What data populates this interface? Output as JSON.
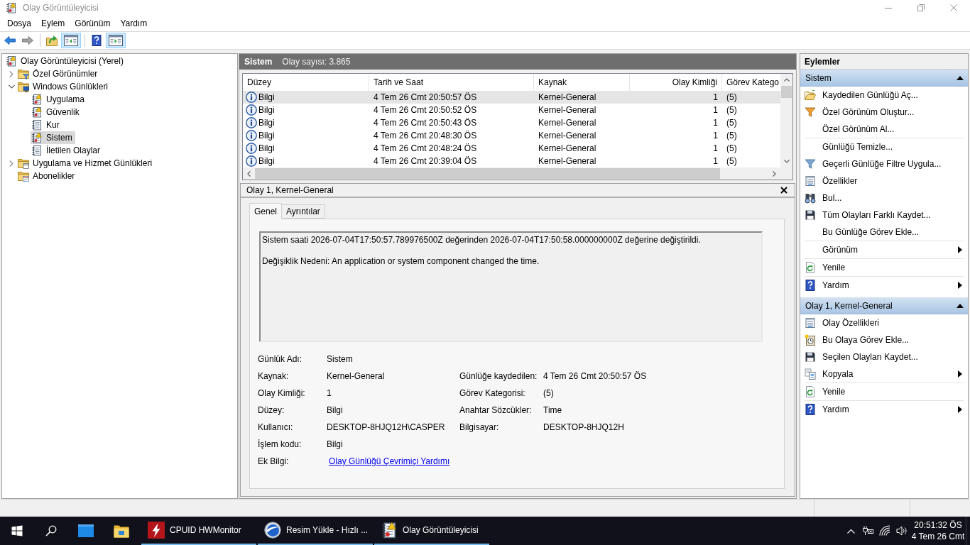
{
  "window": {
    "title": "Olay Görüntüleyicisi"
  },
  "menu": [
    {
      "label": "Dosya"
    },
    {
      "label": "Eylem"
    },
    {
      "label": "Görünüm"
    },
    {
      "label": "Yardım"
    }
  ],
  "toolbar": [
    [
      {
        "kind": "back",
        "disabled": false,
        "pressed": false
      },
      {
        "kind": "forward",
        "disabled": true,
        "pressed": false
      }
    ],
    [
      {
        "kind": "up",
        "disabled": false,
        "pressed": false
      },
      {
        "kind": "show-tree",
        "disabled": false,
        "pressed": true
      }
    ],
    [
      {
        "kind": "help",
        "disabled": false,
        "pressed": false
      },
      {
        "kind": "show-actions",
        "disabled": false,
        "pressed": true
      }
    ]
  ],
  "tree": [
    {
      "label": "Olay Görüntüleyicisi (Yerel)",
      "kind": "event-viewer",
      "selected": false,
      "children": [
        {
          "label": "Özel Görünümler",
          "kind": "filter-folder",
          "expanded": false,
          "selected": false
        },
        {
          "label": "Windows Günlükleri",
          "kind": "windows-folder",
          "expanded": true,
          "selected": false,
          "children": [
            {
              "label": "Uygulama",
              "kind": "log-alert",
              "selected": false
            },
            {
              "label": "Güvenlik",
              "kind": "log-alert",
              "selected": false
            },
            {
              "label": "Kur",
              "kind": "log",
              "selected": false
            },
            {
              "label": "Sistem",
              "kind": "log-alert",
              "selected": true
            },
            {
              "label": "İletilen Olaylar",
              "kind": "log",
              "selected": false
            }
          ]
        },
        {
          "label": "Uygulama ve Hizmet Günlükleri",
          "kind": "folder",
          "expanded": false,
          "selected": false
        },
        {
          "label": "Abonelikler",
          "kind": "subscription-folder",
          "selected": false
        }
      ]
    }
  ],
  "event_list": {
    "title": "Sistem",
    "count": "Olay sayısı: 3.865",
    "columns": [
      "Düzey",
      "Tarih ve Saat",
      "Kaynak",
      "Olay Kimliği",
      "Görev Katego"
    ],
    "rows": [
      {
        "level": "Bilgi",
        "date": "4 Tem 26 Cmt 20:50:57 ÖS",
        "source": "Kernel-General",
        "event_id": "1",
        "category": "(5)",
        "selected": true
      },
      {
        "level": "Bilgi",
        "date": "4 Tem 26 Cmt 20:50:52 ÖS",
        "source": "Kernel-General",
        "event_id": "1",
        "category": "(5)",
        "selected": false
      },
      {
        "level": "Bilgi",
        "date": "4 Tem 26 Cmt 20:50:43 ÖS",
        "source": "Kernel-General",
        "event_id": "1",
        "category": "(5)",
        "selected": false
      },
      {
        "level": "Bilgi",
        "date": "4 Tem 26 Cmt 20:48:30 ÖS",
        "source": "Kernel-General",
        "event_id": "1",
        "category": "(5)",
        "selected": false
      },
      {
        "level": "Bilgi",
        "date": "4 Tem 26 Cmt 20:48:24 ÖS",
        "source": "Kernel-General",
        "event_id": "1",
        "category": "(5)",
        "selected": false
      },
      {
        "level": "Bilgi",
        "date": "4 Tem 26 Cmt 20:39:04 ÖS",
        "source": "Kernel-General",
        "event_id": "1",
        "category": "(5)",
        "selected": false
      }
    ]
  },
  "event_detail": {
    "title": "Olay 1, Kernel-General",
    "tabs": [
      {
        "label": "Genel",
        "selected": true
      },
      {
        "label": "Ayrıntılar",
        "selected": false
      }
    ],
    "message": [
      "Sistem saati 2026-07-04T17:50:57.789976500Z değerinden 2026-07-04T17:50:58.000000000Z değerine değiştirildi.",
      "Değişiklik Nedeni: An application or system component changed the time."
    ],
    "properties": [
      [
        {
          "label": "Günlük Adı:",
          "value": "Sistem"
        }
      ],
      [
        {
          "label": "Kaynak:",
          "value": "Kernel-General"
        },
        {
          "label": "Günlüğe kaydedilen:",
          "value": "4 Tem 26 Cmt 20:50:57 ÖS"
        }
      ],
      [
        {
          "label": "Olay Kimliği:",
          "value": "1"
        },
        {
          "label": "Görev Kategorisi:",
          "value": "(5)"
        }
      ],
      [
        {
          "label": "Düzey:",
          "value": "Bilgi"
        },
        {
          "label": "Anahtar Sözcükler:",
          "value": "Time"
        }
      ],
      [
        {
          "label": "Kullanıcı:",
          "value": "DESKTOP-8HJQ12H\\CASPER"
        },
        {
          "label": "Bilgisayar:",
          "value": "DESKTOP-8HJQ12H"
        }
      ],
      [
        {
          "label": "İşlem kodu:",
          "value": "Bilgi"
        }
      ],
      [
        {
          "label": "Ek Bilgi:",
          "link": "Olay Günlüğü Çevrimiçi Yardımı"
        }
      ]
    ]
  },
  "actions": {
    "title": "Eylemler",
    "sections": [
      {
        "title": "Sistem",
        "expanded": true,
        "groups": [
          [
            {
              "label": "Kaydedilen Günlüğü Aç...",
              "kind": "open-log",
              "submenu": false
            },
            {
              "label": "Özel Görünüm Oluştur...",
              "kind": "create-view",
              "submenu": false
            },
            {
              "label": "Özel Görünüm Al...",
              "kind": "import-view",
              "submenu": false
            }
          ],
          [
            {
              "label": "Günlüğü Temizle...",
              "kind": "clear-log",
              "submenu": false
            },
            {
              "label": "Geçerli Günlüğe Filtre Uygula...",
              "kind": "filter",
              "submenu": false
            },
            {
              "label": "Özellikler",
              "kind": "properties",
              "submenu": false
            },
            {
              "label": "Bul...",
              "kind": "find",
              "submenu": false
            },
            {
              "label": "Tüm Olayları Farklı Kaydet...",
              "kind": "save",
              "submenu": false
            },
            {
              "label": "Bu Günlüğe Görev Ekle...",
              "kind": "attach-task",
              "submenu": false
            }
          ],
          [
            {
              "label": "Görünüm",
              "kind": "view",
              "submenu": true
            }
          ],
          [
            {
              "label": "Yenile",
              "kind": "refresh",
              "submenu": false
            }
          ],
          [
            {
              "label": "Yardım",
              "kind": "help",
              "submenu": true
            }
          ]
        ]
      },
      {
        "title": "Olay 1, Kernel-General",
        "expanded": true,
        "groups": [
          [
            {
              "label": "Olay Özellikleri",
              "kind": "properties",
              "submenu": false
            },
            {
              "label": "Bu Olaya Görev Ekle...",
              "kind": "attach-task-event",
              "submenu": false
            },
            {
              "label": "Seçilen Olayları Kaydet...",
              "kind": "save",
              "submenu": false
            },
            {
              "label": "Kopyala",
              "kind": "copy",
              "submenu": true
            }
          ],
          [
            {
              "label": "Yenile",
              "kind": "refresh",
              "submenu": false
            }
          ],
          [
            {
              "label": "Yardım",
              "kind": "help",
              "submenu": true
            }
          ]
        ]
      }
    ]
  },
  "taskbar": {
    "apps": [
      {
        "label": "CPUID HWMonitor",
        "kind": "hwmonitor"
      },
      {
        "label": "Resim Yükle - Hızlı ...",
        "kind": "browser"
      },
      {
        "label": "Olay Görüntüleyicisi",
        "kind": "event-viewer"
      }
    ],
    "clock": {
      "time": "20:51:32 ÖS",
      "date": "4 Tem 26 Cmt"
    }
  }
}
